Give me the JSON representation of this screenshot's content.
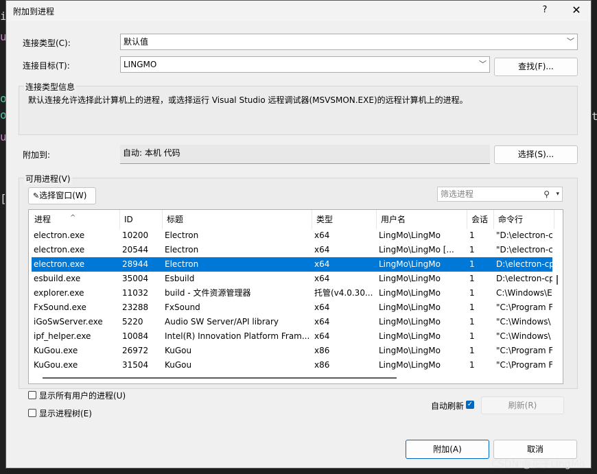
{
  "dialog": {
    "title": "附加到进程",
    "help": "?",
    "close": "✕"
  },
  "connection": {
    "type_label": "连接类型(C):",
    "type_value": "默认值",
    "target_label": "连接目标(T):",
    "target_value": "LINGMO",
    "find_button": "查找(F)...",
    "info_group_label": "连接类型信息",
    "info_text": "默认连接允许选择此计算机上的进程，或选择运行 Visual Studio 远程调试器(MSVSMON.EXE)的远程计算机上的进程。"
  },
  "attach_to": {
    "label": "附加到:",
    "value": "自动: 本机 代码",
    "select_button": "选择(S)..."
  },
  "processes": {
    "group_label": "可用进程(V)",
    "select_window_button": "选择窗口(W)",
    "filter_placeholder": "筛选进程",
    "columns": [
      "进程",
      "ID",
      "标题",
      "类型",
      "用户名",
      "会话",
      "命令行"
    ],
    "rows": [
      {
        "process": "electron.exe",
        "id": "10200",
        "title": "Electron",
        "type": "x64",
        "user": "LingMo\\LingMo",
        "session": "1",
        "cmd": "\"D:\\electron-c"
      },
      {
        "process": "electron.exe",
        "id": "20544",
        "title": "Electron",
        "type": "x64",
        "user": "LingMo\\LingMo [...",
        "session": "1",
        "cmd": "\"D:\\electron-c"
      },
      {
        "process": "electron.exe",
        "id": "28944",
        "title": "Electron",
        "type": "x64",
        "user": "LingMo\\LingMo",
        "session": "1",
        "cmd": "D:\\electron-cp",
        "selected": true
      },
      {
        "process": "esbuild.exe",
        "id": "35004",
        "title": "Esbuild",
        "type": "x64",
        "user": "LingMo\\LingMo",
        "session": "1",
        "cmd": "D:\\electron-cp"
      },
      {
        "process": "explorer.exe",
        "id": "11032",
        "title": "build - 文件资源管理器",
        "type": "托管(v4.0.30...",
        "user": "LingMo\\LingMo",
        "session": "1",
        "cmd": "C:\\Windows\\E"
      },
      {
        "process": "FxSound.exe",
        "id": "23288",
        "title": "FxSound",
        "type": "x64",
        "user": "LingMo\\LingMo",
        "session": "1",
        "cmd": "\"C:\\Program F"
      },
      {
        "process": "iGoSwServer.exe",
        "id": "5220",
        "title": "Audio SW Server/API library",
        "type": "x64",
        "user": "LingMo\\LingMo",
        "session": "1",
        "cmd": "\"C:\\Windows\\"
      },
      {
        "process": "ipf_helper.exe",
        "id": "10084",
        "title": "Intel(R) Innovation Platform Fram...",
        "type": "x64",
        "user": "LingMo\\LingMo",
        "session": "1",
        "cmd": "\"C:\\Windows\\"
      },
      {
        "process": "KuGou.exe",
        "id": "26972",
        "title": "KuGou",
        "type": "x86",
        "user": "LingMo\\LingMo",
        "session": "1",
        "cmd": "\"C:\\Program F"
      },
      {
        "process": "KuGou.exe",
        "id": "31504",
        "title": "KuGou",
        "type": "x86",
        "user": "LingMo\\LingMo",
        "session": "1",
        "cmd": "\"C:\\Program F"
      }
    ],
    "show_all_users": "显示所有用户的进程(U)",
    "show_tree": "显示进程树(E)",
    "auto_refresh_label": "自动刷新",
    "refresh_button": "刷新(R)"
  },
  "footer": {
    "attach_button": "附加(A)",
    "cancel_button": "取消"
  },
  "watermark": "CSDN @花子LingMo",
  "colors": {
    "selection": "#0078d7",
    "accent": "#0067c0"
  }
}
